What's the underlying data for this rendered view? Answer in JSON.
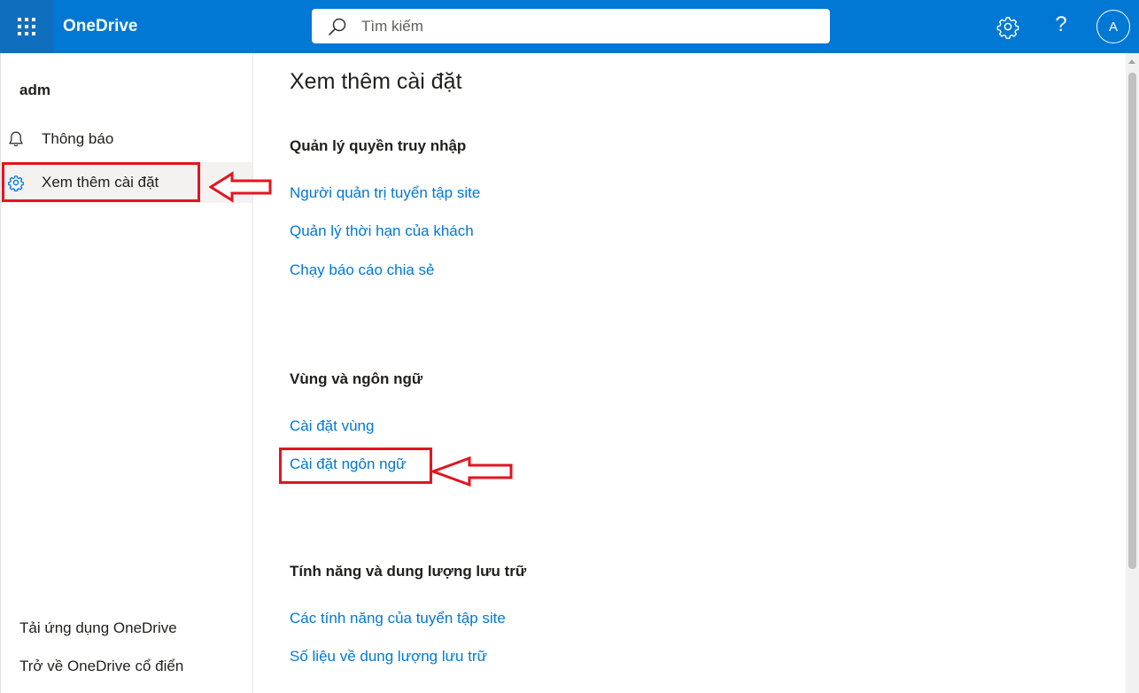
{
  "header": {
    "app_name": "OneDrive",
    "search_placeholder": "Tìm kiếm",
    "help_label": "?",
    "avatar_initial": "A"
  },
  "sidebar": {
    "user": "adm",
    "items": [
      {
        "label": "Thông báo",
        "icon": "bell-icon"
      },
      {
        "label": "Xem thêm cài đặt",
        "icon": "gear-icon",
        "selected": true
      }
    ],
    "footer_links": [
      "Tải ứng dụng OneDrive",
      "Trở về OneDrive cổ điển"
    ]
  },
  "main": {
    "title": "Xem thêm cài đặt",
    "sections": [
      {
        "heading": "Quản lý quyền truy nhập",
        "links": [
          "Người quản trị tuyển tập site",
          "Quản lý thời hạn của khách",
          "Chạy báo cáo chia sẻ"
        ]
      },
      {
        "heading": "Vùng và ngôn ngữ",
        "links": [
          "Cài đặt vùng",
          "Cài đặt ngôn ngữ"
        ]
      },
      {
        "heading": "Tính năng và dung lượng lưu trữ",
        "links": [
          "Các tính năng của tuyển tập site",
          "Số liệu về dung lượng lưu trữ"
        ]
      }
    ]
  },
  "colors": {
    "accent": "#0078d4",
    "annotation": "#e3141f"
  }
}
